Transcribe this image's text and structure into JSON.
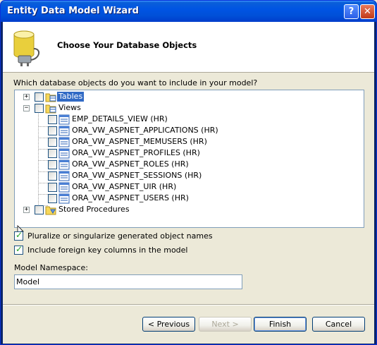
{
  "window": {
    "title": "Entity Data Model Wizard",
    "help_glyph": "?",
    "close_glyph": "✕"
  },
  "banner": {
    "title": "Choose Your Database Objects",
    "icon": "database-plug-icon"
  },
  "question": "Which database objects do you want to include in your model?",
  "tree": {
    "tables": {
      "label": "Tables",
      "expander": "+"
    },
    "views": {
      "label": "Views",
      "expander": "−",
      "items": [
        "EMP_DETAILS_VIEW (HR)",
        "ORA_VW_ASPNET_APPLICATIONS (HR)",
        "ORA_VW_ASPNET_MEMUSERS (HR)",
        "ORA_VW_ASPNET_PROFILES (HR)",
        "ORA_VW_ASPNET_ROLES (HR)",
        "ORA_VW_ASPNET_SESSIONS (HR)",
        "ORA_VW_ASPNET_UIR (HR)",
        "ORA_VW_ASPNET_USERS (HR)"
      ]
    },
    "procedures": {
      "label": "Stored Procedures",
      "expander": "+"
    }
  },
  "options": {
    "pluralize": "Pluralize or singularize generated object names",
    "foreign_keys": "Include foreign key columns in the model"
  },
  "namespace": {
    "label": "Model Namespace:",
    "value": "Model"
  },
  "buttons": {
    "previous": "< Previous",
    "next": "Next >",
    "finish": "Finish",
    "cancel": "Cancel"
  },
  "colors": {
    "title_bar": "#0054e3",
    "selection": "#316ac5",
    "check": "#21a121"
  }
}
